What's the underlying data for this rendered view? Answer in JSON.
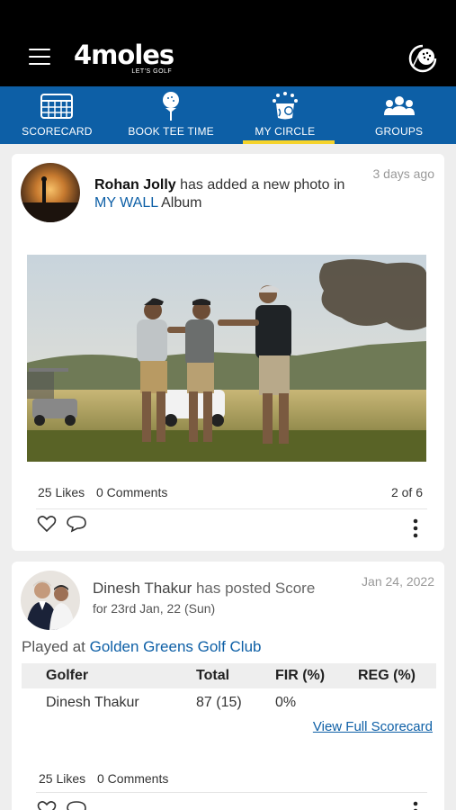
{
  "app": {
    "logo_text": "4moles",
    "logo_tagline": "LET'S GOLF"
  },
  "icons": {
    "menu": "menu-icon",
    "golf": "golf-ball-icon"
  },
  "colors": {
    "brand_blue": "#0d5fa6",
    "active_tab_indicator": "#f5d32b",
    "top_bar": "#000000"
  },
  "tabs": [
    {
      "label": "SCORECARD",
      "icon": "scorecard-icon",
      "active": false
    },
    {
      "label": "BOOK TEE TIME",
      "icon": "tee-icon",
      "active": false
    },
    {
      "label": "MY CIRCLE",
      "icon": "my-circle-icon",
      "active": true
    },
    {
      "label": "GROUPS",
      "icon": "groups-icon",
      "active": false
    }
  ],
  "feed": [
    {
      "user": "Rohan Jolly",
      "action": " has added a new photo in",
      "album_name": "MY WALL",
      "album_suffix": " Album",
      "time": "3 days ago",
      "likes": "25 Likes",
      "comments": "0 Comments",
      "pager": "2 of 6"
    },
    {
      "user": "Dinesh Thakur",
      "action": " has posted Score",
      "sub": "for 23rd Jan, 22 (Sun)",
      "time": "Jan 24, 2022",
      "played_prefix": "Played at ",
      "course": "Golden Greens Golf Club",
      "table": {
        "headers": [
          "Golfer",
          "Total",
          "FIR (%)",
          "REG (%)"
        ],
        "rows": [
          [
            "Dinesh Thakur",
            "87 (15)",
            "0%",
            ""
          ]
        ]
      },
      "view_link": "View Full Scorecard",
      "likes": "25 Likes",
      "comments": "0 Comments"
    }
  ]
}
